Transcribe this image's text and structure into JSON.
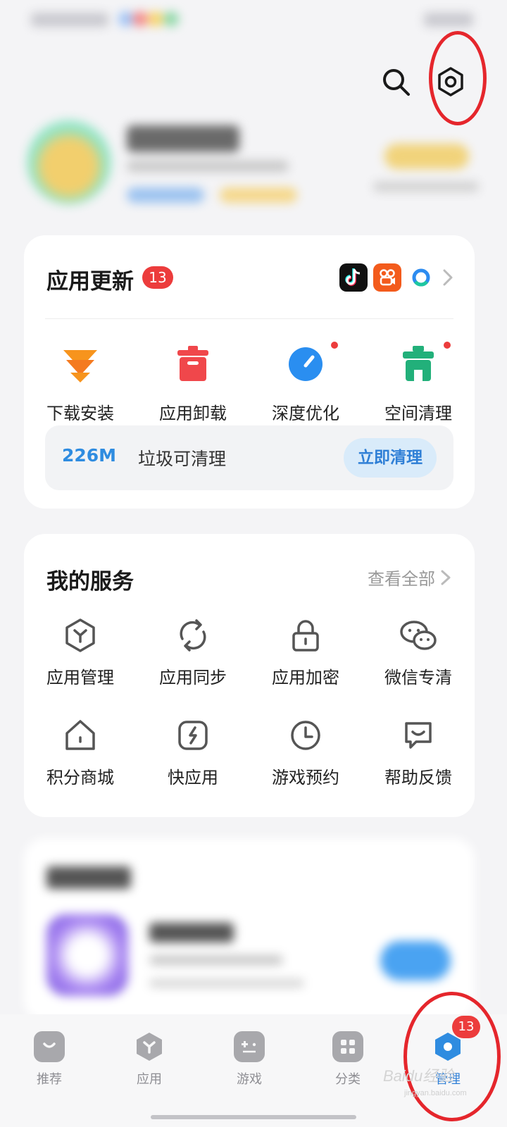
{
  "updates": {
    "title": "应用更新",
    "badge": "13",
    "apps": [
      "tiktok-icon",
      "kuaishou-icon",
      "qq-browser-icon"
    ]
  },
  "tools": [
    {
      "label": "下载安装",
      "icon": "download-icon",
      "dot": false
    },
    {
      "label": "应用卸载",
      "icon": "uninstall-icon",
      "dot": false
    },
    {
      "label": "深度优化",
      "icon": "optimize-icon",
      "dot": true
    },
    {
      "label": "空间清理",
      "icon": "cleanup-icon",
      "dot": true
    }
  ],
  "clean": {
    "size": "226M",
    "text": "垃圾可清理",
    "button": "立即清理"
  },
  "services": {
    "title": "我的服务",
    "view_all": "查看全部",
    "items": [
      {
        "label": "应用管理",
        "icon": "app-manage-icon"
      },
      {
        "label": "应用同步",
        "icon": "sync-icon"
      },
      {
        "label": "应用加密",
        "icon": "lock-icon"
      },
      {
        "label": "微信专清",
        "icon": "wechat-icon"
      },
      {
        "label": "积分商城",
        "icon": "store-icon"
      },
      {
        "label": "快应用",
        "icon": "quick-app-icon"
      },
      {
        "label": "游戏预约",
        "icon": "clock-icon"
      },
      {
        "label": "帮助反馈",
        "icon": "feedback-icon"
      }
    ]
  },
  "nav": {
    "items": [
      "推荐",
      "应用",
      "游戏",
      "分类",
      "管理"
    ],
    "active": "管理",
    "badge": "13"
  },
  "watermark": {
    "brand": "Baidu经验",
    "url": "jingyan.baidu.com"
  },
  "colors": {
    "accent": "#2f7fd6",
    "badge": "#ec3c3c",
    "annotation": "#e5262c"
  }
}
